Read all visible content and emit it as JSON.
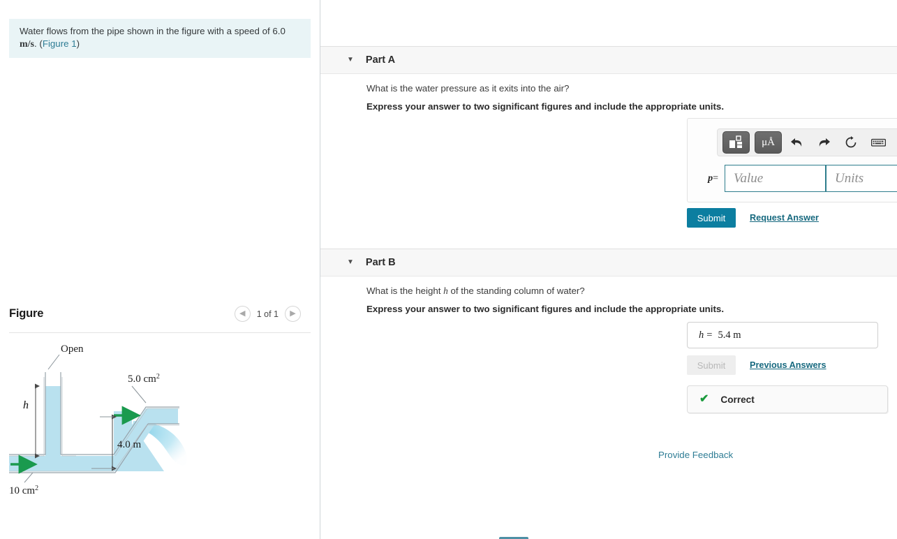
{
  "problem": {
    "text_before": "Water flows from the pipe shown in the figure with a speed of 6.0 ",
    "speed_units": "m/s",
    "text_after": ". (",
    "figure_link": "Figure 1",
    "text_end": ")"
  },
  "figure_panel": {
    "title": "Figure",
    "prev_icon": "chevron-left-icon",
    "next_icon": "chevron-right-icon",
    "counter": "1 of 1",
    "labels": {
      "open": "Open",
      "h": "h",
      "area_in": "10 cm",
      "area_in_sup": "2",
      "area_out": "5.0 cm",
      "area_out_sup": "2",
      "height": "4.0 m"
    },
    "colors": {
      "water": "#b8e0ef",
      "pipe_outline": "#9aa5ad",
      "arrow_green": "#1a9a4e",
      "jet": "#a9dcef"
    }
  },
  "parts": [
    {
      "id": "part-a",
      "caret_icon": "caret-down-icon",
      "label": "Part A",
      "question": "What is the water pressure as it exits into the air?",
      "instruction": "Express your answer to two significant figures and include the appropriate units.",
      "toolbar": [
        {
          "name": "template-icon",
          "glyph": "■"
        },
        {
          "name": "units-icon",
          "glyph": "μÅ"
        },
        {
          "name": "undo-icon",
          "glyph": "↶"
        },
        {
          "name": "redo-icon",
          "glyph": "↷"
        },
        {
          "name": "reset-icon",
          "glyph": "↻"
        },
        {
          "name": "keyboard-icon",
          "glyph": "⌨"
        },
        {
          "name": "help-icon",
          "glyph": "?"
        }
      ],
      "variable": "p",
      "equals": "=",
      "value_placeholder": "Value",
      "units_placeholder": "Units",
      "value": "",
      "units": "",
      "submit_label": "Submit",
      "secondary_link": "Request Answer"
    },
    {
      "id": "part-b",
      "caret_icon": "caret-down-icon",
      "label": "Part B",
      "question_before": "What is the height ",
      "question_var": "h",
      "question_after": " of the standing column of water?",
      "instruction": "Express your answer to two significant figures and include the appropriate units.",
      "variable": "h",
      "equals": "=",
      "answer": "5.4 m",
      "submit_label": "Submit",
      "secondary_link": "Previous Answers",
      "status_icon": "check-icon",
      "status_label": "Correct"
    }
  ],
  "footer": {
    "feedback_label": "Provide Feedback"
  },
  "theme": {
    "accent": "#0c7ea0",
    "link": "#2f7d95",
    "success": "#1a9a3c",
    "problem_bg": "#e9f4f6",
    "header_bg": "#f7f7f7"
  }
}
